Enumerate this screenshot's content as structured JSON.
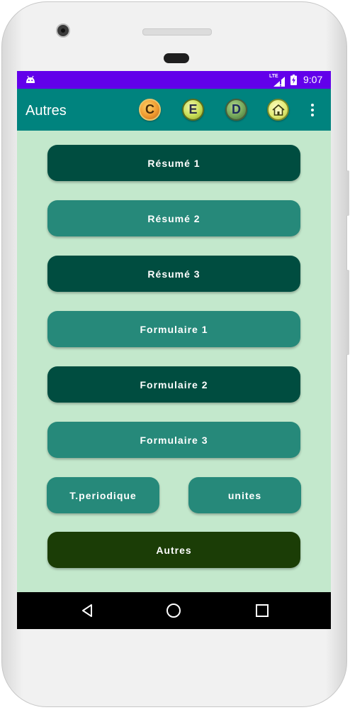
{
  "status_bar": {
    "network": "LTE",
    "time": "9:07"
  },
  "app_bar": {
    "title": "Autres",
    "badges": [
      {
        "letter": "C",
        "name": "c-badge-icon"
      },
      {
        "letter": "E",
        "name": "e-badge-icon"
      },
      {
        "letter": "D",
        "name": "d-badge-icon"
      },
      {
        "letter": "",
        "name": "home-icon"
      }
    ],
    "menu_icon": "overflow-menu-icon"
  },
  "buttons": {
    "resume1": "Résumé 1",
    "resume2": "Résumé 2",
    "resume3": "Résumé 3",
    "formulaire1": "Formulaire 1",
    "formulaire2": "Formulaire 2",
    "formulaire3": "Formulaire 3",
    "tperiodique": "T.periodique",
    "unites": "unites",
    "autres": "Autres"
  },
  "nav_bar": {
    "icons": [
      "back-icon",
      "home-circle-icon",
      "recents-icon"
    ]
  },
  "colors": {
    "status_bar": "#6200ea",
    "app_bar": "#00837e",
    "background": "#c3e8cc",
    "button_dark": "#004d40",
    "button_light": "#26897a",
    "button_olive": "#1b3d06"
  }
}
